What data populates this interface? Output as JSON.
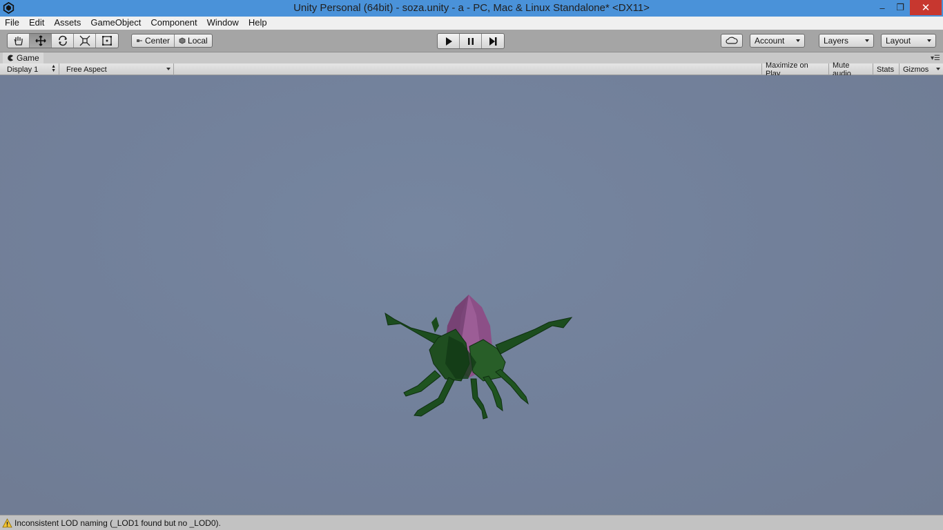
{
  "window": {
    "title": "Unity Personal (64bit) - soza.unity - a - PC, Mac & Linux Standalone* <DX11>",
    "minimize": "–",
    "maximize": "❐",
    "close": "✕"
  },
  "menu": [
    "File",
    "Edit",
    "Assets",
    "GameObject",
    "Component",
    "Window",
    "Help"
  ],
  "toolbar": {
    "tools": [
      {
        "name": "hand-tool",
        "icon": "hand-icon",
        "active": false
      },
      {
        "name": "move-tool",
        "icon": "move-icon",
        "active": true
      },
      {
        "name": "rotate-tool",
        "icon": "rotate-icon",
        "active": false
      },
      {
        "name": "scale-tool",
        "icon": "scale-icon",
        "active": false
      },
      {
        "name": "rect-tool",
        "icon": "rect-icon",
        "active": false
      }
    ],
    "pivot_mode": "Center",
    "pivot_rotation": "Local",
    "account_label": "Account",
    "layers_label": "Layers",
    "layout_label": "Layout"
  },
  "game_panel": {
    "tab_label": "Game",
    "display": "Display 1",
    "aspect": "Free Aspect",
    "maximize_on_play": "Maximize on Play",
    "mute_audio": "Mute audio",
    "stats": "Stats",
    "gizmos": "Gizmos"
  },
  "status": {
    "message": "Inconsistent LOD naming (_LOD1 found but no _LOD0)."
  },
  "colors": {
    "titlebar": "#4a92d9",
    "close_button": "#c7372f",
    "game_background": "#72809a",
    "warning": "#f4c430"
  }
}
